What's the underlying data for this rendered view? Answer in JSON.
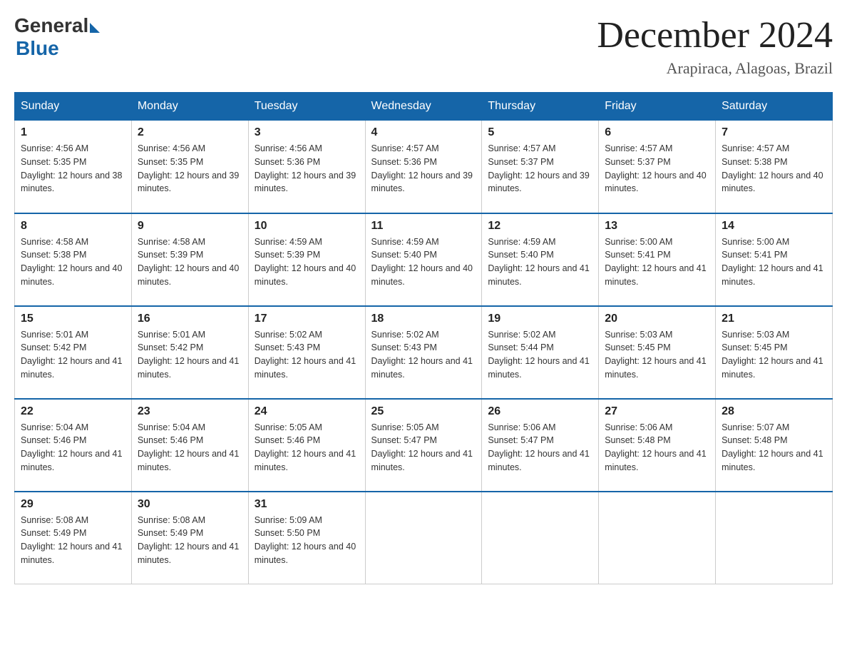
{
  "header": {
    "logo_general": "General",
    "logo_blue": "Blue",
    "month": "December 2024",
    "location": "Arapiraca, Alagoas, Brazil"
  },
  "weekdays": [
    "Sunday",
    "Monday",
    "Tuesday",
    "Wednesday",
    "Thursday",
    "Friday",
    "Saturday"
  ],
  "weeks": [
    [
      {
        "day": "1",
        "sunrise": "4:56 AM",
        "sunset": "5:35 PM",
        "daylight": "12 hours and 38 minutes."
      },
      {
        "day": "2",
        "sunrise": "4:56 AM",
        "sunset": "5:35 PM",
        "daylight": "12 hours and 39 minutes."
      },
      {
        "day": "3",
        "sunrise": "4:56 AM",
        "sunset": "5:36 PM",
        "daylight": "12 hours and 39 minutes."
      },
      {
        "day": "4",
        "sunrise": "4:57 AM",
        "sunset": "5:36 PM",
        "daylight": "12 hours and 39 minutes."
      },
      {
        "day": "5",
        "sunrise": "4:57 AM",
        "sunset": "5:37 PM",
        "daylight": "12 hours and 39 minutes."
      },
      {
        "day": "6",
        "sunrise": "4:57 AM",
        "sunset": "5:37 PM",
        "daylight": "12 hours and 40 minutes."
      },
      {
        "day": "7",
        "sunrise": "4:57 AM",
        "sunset": "5:38 PM",
        "daylight": "12 hours and 40 minutes."
      }
    ],
    [
      {
        "day": "8",
        "sunrise": "4:58 AM",
        "sunset": "5:38 PM",
        "daylight": "12 hours and 40 minutes."
      },
      {
        "day": "9",
        "sunrise": "4:58 AM",
        "sunset": "5:39 PM",
        "daylight": "12 hours and 40 minutes."
      },
      {
        "day": "10",
        "sunrise": "4:59 AM",
        "sunset": "5:39 PM",
        "daylight": "12 hours and 40 minutes."
      },
      {
        "day": "11",
        "sunrise": "4:59 AM",
        "sunset": "5:40 PM",
        "daylight": "12 hours and 40 minutes."
      },
      {
        "day": "12",
        "sunrise": "4:59 AM",
        "sunset": "5:40 PM",
        "daylight": "12 hours and 41 minutes."
      },
      {
        "day": "13",
        "sunrise": "5:00 AM",
        "sunset": "5:41 PM",
        "daylight": "12 hours and 41 minutes."
      },
      {
        "day": "14",
        "sunrise": "5:00 AM",
        "sunset": "5:41 PM",
        "daylight": "12 hours and 41 minutes."
      }
    ],
    [
      {
        "day": "15",
        "sunrise": "5:01 AM",
        "sunset": "5:42 PM",
        "daylight": "12 hours and 41 minutes."
      },
      {
        "day": "16",
        "sunrise": "5:01 AM",
        "sunset": "5:42 PM",
        "daylight": "12 hours and 41 minutes."
      },
      {
        "day": "17",
        "sunrise": "5:02 AM",
        "sunset": "5:43 PM",
        "daylight": "12 hours and 41 minutes."
      },
      {
        "day": "18",
        "sunrise": "5:02 AM",
        "sunset": "5:43 PM",
        "daylight": "12 hours and 41 minutes."
      },
      {
        "day": "19",
        "sunrise": "5:02 AM",
        "sunset": "5:44 PM",
        "daylight": "12 hours and 41 minutes."
      },
      {
        "day": "20",
        "sunrise": "5:03 AM",
        "sunset": "5:45 PM",
        "daylight": "12 hours and 41 minutes."
      },
      {
        "day": "21",
        "sunrise": "5:03 AM",
        "sunset": "5:45 PM",
        "daylight": "12 hours and 41 minutes."
      }
    ],
    [
      {
        "day": "22",
        "sunrise": "5:04 AM",
        "sunset": "5:46 PM",
        "daylight": "12 hours and 41 minutes."
      },
      {
        "day": "23",
        "sunrise": "5:04 AM",
        "sunset": "5:46 PM",
        "daylight": "12 hours and 41 minutes."
      },
      {
        "day": "24",
        "sunrise": "5:05 AM",
        "sunset": "5:46 PM",
        "daylight": "12 hours and 41 minutes."
      },
      {
        "day": "25",
        "sunrise": "5:05 AM",
        "sunset": "5:47 PM",
        "daylight": "12 hours and 41 minutes."
      },
      {
        "day": "26",
        "sunrise": "5:06 AM",
        "sunset": "5:47 PM",
        "daylight": "12 hours and 41 minutes."
      },
      {
        "day": "27",
        "sunrise": "5:06 AM",
        "sunset": "5:48 PM",
        "daylight": "12 hours and 41 minutes."
      },
      {
        "day": "28",
        "sunrise": "5:07 AM",
        "sunset": "5:48 PM",
        "daylight": "12 hours and 41 minutes."
      }
    ],
    [
      {
        "day": "29",
        "sunrise": "5:08 AM",
        "sunset": "5:49 PM",
        "daylight": "12 hours and 41 minutes."
      },
      {
        "day": "30",
        "sunrise": "5:08 AM",
        "sunset": "5:49 PM",
        "daylight": "12 hours and 41 minutes."
      },
      {
        "day": "31",
        "sunrise": "5:09 AM",
        "sunset": "5:50 PM",
        "daylight": "12 hours and 40 minutes."
      },
      null,
      null,
      null,
      null
    ]
  ]
}
